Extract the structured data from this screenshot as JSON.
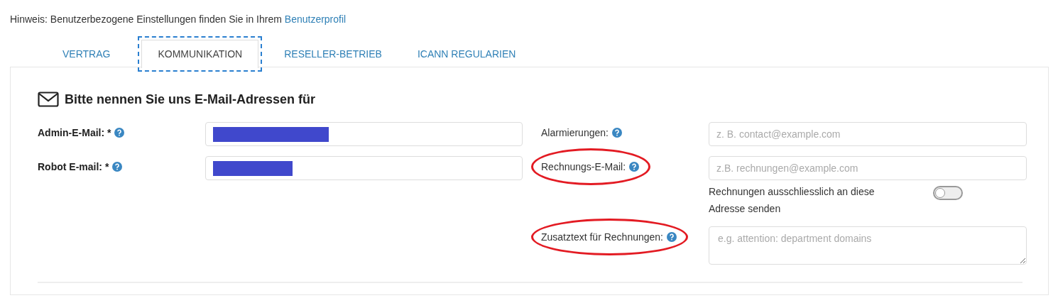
{
  "notice": {
    "text": "Hinweis: Benutzerbezogene Einstellungen finden Sie in Ihrem",
    "link": "Benutzerprofil"
  },
  "tabs": [
    {
      "label": "VERTRAG",
      "selected": false
    },
    {
      "label": "KOMMUNIKATION",
      "selected": true
    },
    {
      "label": "RESELLER-BETRIEB",
      "selected": false
    },
    {
      "label": "ICANN REGULARIEN",
      "selected": false
    }
  ],
  "section": {
    "title": "Bitte nennen Sie uns E-Mail-Adressen für"
  },
  "left_fields": [
    {
      "kind": "input",
      "label": "Admin-E-Mail: *",
      "help": true,
      "redacted": true,
      "circled": false
    },
    {
      "kind": "input",
      "label": "Robot E-mail: *",
      "help": true,
      "redacted": true,
      "circled": false
    }
  ],
  "right_fields": [
    {
      "kind": "input",
      "label": "Alarmierungen:",
      "help": true,
      "placeholder": "z. B. contact@example.com",
      "circled": false
    },
    {
      "kind": "input",
      "label": "Rechnungs-E-Mail:",
      "help": true,
      "placeholder": "z.B. rechnungen@example.com",
      "circled": true
    },
    {
      "kind": "toggle",
      "text": "Rechnungen ausschliesslich an diese Adresse senden",
      "on": false
    },
    {
      "kind": "textarea",
      "label": "Zusatztext für Rechnungen:",
      "help": true,
      "placeholder": "e.g. attention: department domains",
      "circled": true
    }
  ]
}
